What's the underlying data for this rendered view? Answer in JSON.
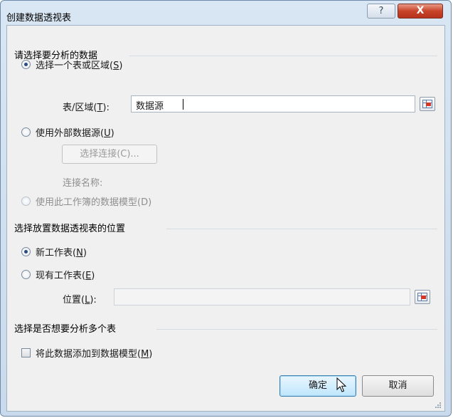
{
  "window": {
    "title": "创建数据透视表",
    "help_label": "?",
    "close_label": "X"
  },
  "source_group": {
    "title": "请选择要分析的数据",
    "radio_table_range": {
      "label": "选择一个表或区域(",
      "key": "S",
      "suffix": ")",
      "checked": true
    },
    "table_range_label": {
      "label": "表/区域(",
      "key": "T",
      "suffix": "):"
    },
    "table_range_value": "数据源",
    "radio_external": {
      "label": "使用外部数据源(",
      "key": "U",
      "suffix": ")",
      "checked": false
    },
    "choose_connection_button": "选择连接(C)...",
    "connection_name_label": "连接名称:",
    "radio_data_model": {
      "label": "使用此工作簿的数据模型(D)",
      "enabled": false
    }
  },
  "location_group": {
    "title": "选择放置数据透视表的位置",
    "radio_new_sheet": {
      "label": "新工作表(",
      "key": "N",
      "suffix": ")",
      "checked": true
    },
    "radio_existing_sheet": {
      "label": "现有工作表(",
      "key": "E",
      "suffix": ")",
      "checked": false
    },
    "location_label": {
      "label": "位置(",
      "key": "L",
      "suffix": "):"
    },
    "location_value": ""
  },
  "multi_group": {
    "title": "选择是否想要分析多个表",
    "add_to_model_checkbox": {
      "label": "将此数据添加到数据模型(",
      "key": "M",
      "suffix": ")",
      "checked": false
    }
  },
  "buttons": {
    "ok": "确定",
    "cancel": "取消"
  }
}
